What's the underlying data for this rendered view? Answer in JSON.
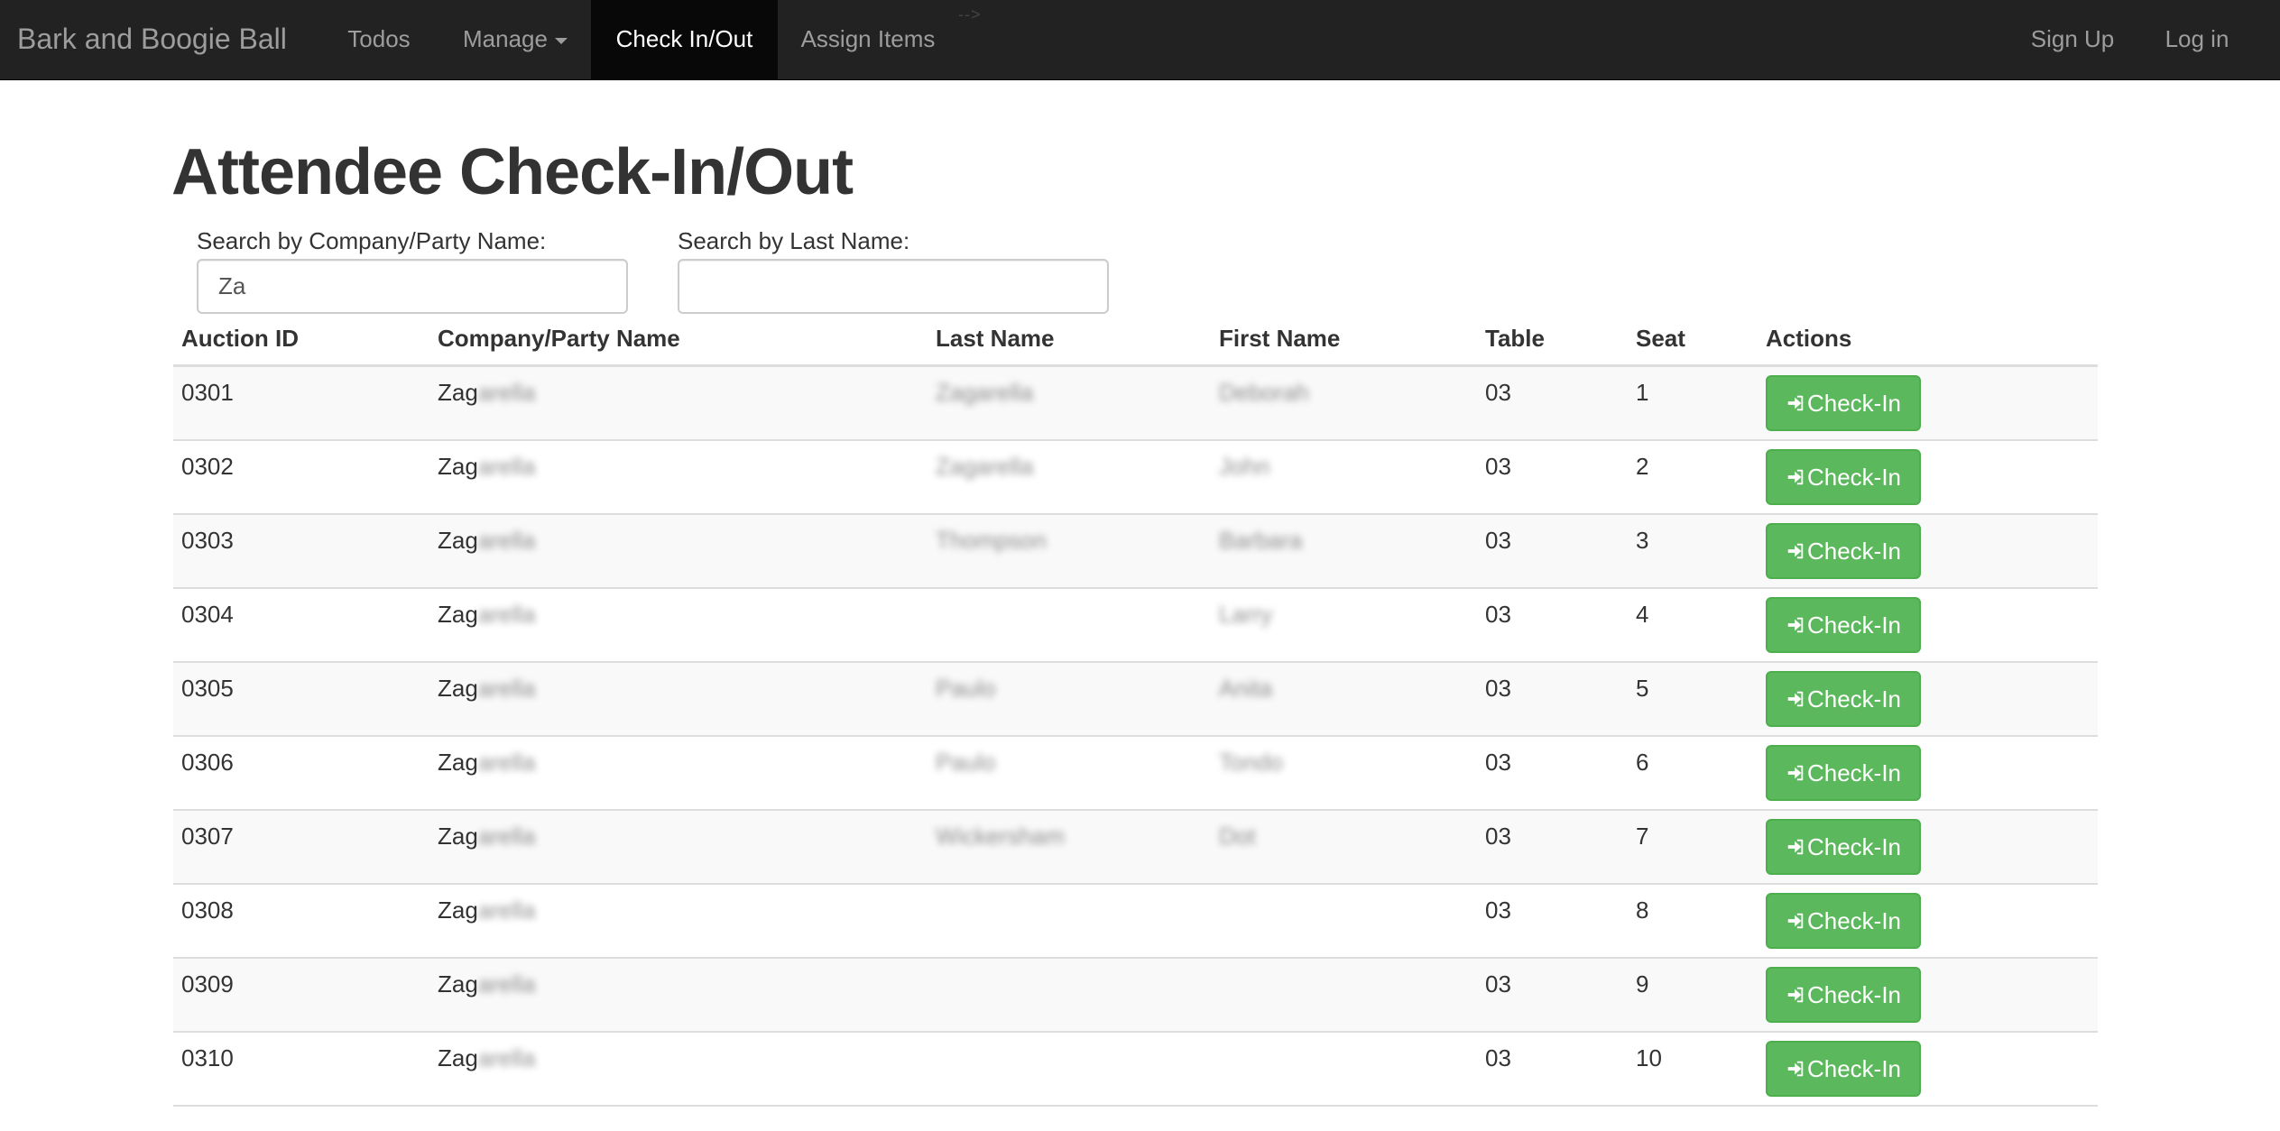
{
  "navbar": {
    "brand": "Bark and Boogie Ball",
    "items": [
      {
        "label": "Todos"
      },
      {
        "label": "Manage"
      },
      {
        "label": "Check In/Out"
      },
      {
        "label": "Assign Items"
      }
    ],
    "artifact_text": "-->",
    "right_items": [
      {
        "label": "Sign Up"
      },
      {
        "label": "Log in"
      }
    ],
    "colors": {
      "background": "#222222",
      "active_background": "#080808",
      "text": "#9d9d9d",
      "active_text": "#ffffff"
    }
  },
  "page": {
    "title": "Attendee Check-In/Out"
  },
  "search": {
    "company_label": "Search by Company/Party Name:",
    "company_value": "Za",
    "lastname_label": "Search by Last Name:",
    "lastname_value": ""
  },
  "table": {
    "headers": {
      "auction_id": "Auction ID",
      "company": "Company/Party Name",
      "last_name": "Last Name",
      "first_name": "First Name",
      "table": "Table",
      "seat": "Seat",
      "actions": "Actions"
    },
    "action_label": "Check-In",
    "action_icon": "log-in-icon",
    "action_color": "#5cb85c",
    "rows": [
      {
        "auction_id": "0301",
        "company_visible": "Zag",
        "company_blurred": "arella",
        "last_name": "Zagarella",
        "first_name": "Deborah",
        "table": "03",
        "seat": "1"
      },
      {
        "auction_id": "0302",
        "company_visible": "Zag",
        "company_blurred": "arella",
        "last_name": "Zagarella",
        "first_name": "John",
        "table": "03",
        "seat": "2"
      },
      {
        "auction_id": "0303",
        "company_visible": "Zag",
        "company_blurred": "arella",
        "last_name": "Thompson",
        "first_name": "Barbara",
        "table": "03",
        "seat": "3"
      },
      {
        "auction_id": "0304",
        "company_visible": "Zag",
        "company_blurred": "arella",
        "last_name": "",
        "first_name": "Larry",
        "table": "03",
        "seat": "4"
      },
      {
        "auction_id": "0305",
        "company_visible": "Zag",
        "company_blurred": "arella",
        "last_name": "Paulo",
        "first_name": "Anita",
        "table": "03",
        "seat": "5"
      },
      {
        "auction_id": "0306",
        "company_visible": "Zag",
        "company_blurred": "arella",
        "last_name": "Paulo",
        "first_name": "Tondo",
        "table": "03",
        "seat": "6"
      },
      {
        "auction_id": "0307",
        "company_visible": "Zag",
        "company_blurred": "arella",
        "last_name": "Wickersham",
        "first_name": "Dot",
        "table": "03",
        "seat": "7"
      },
      {
        "auction_id": "0308",
        "company_visible": "Zag",
        "company_blurred": "arella",
        "last_name": "",
        "first_name": "",
        "table": "03",
        "seat": "8"
      },
      {
        "auction_id": "0309",
        "company_visible": "Zag",
        "company_blurred": "arella",
        "last_name": "",
        "first_name": "",
        "table": "03",
        "seat": "9"
      },
      {
        "auction_id": "0310",
        "company_visible": "Zag",
        "company_blurred": "arella",
        "last_name": "",
        "first_name": "",
        "table": "03",
        "seat": "10"
      }
    ]
  }
}
